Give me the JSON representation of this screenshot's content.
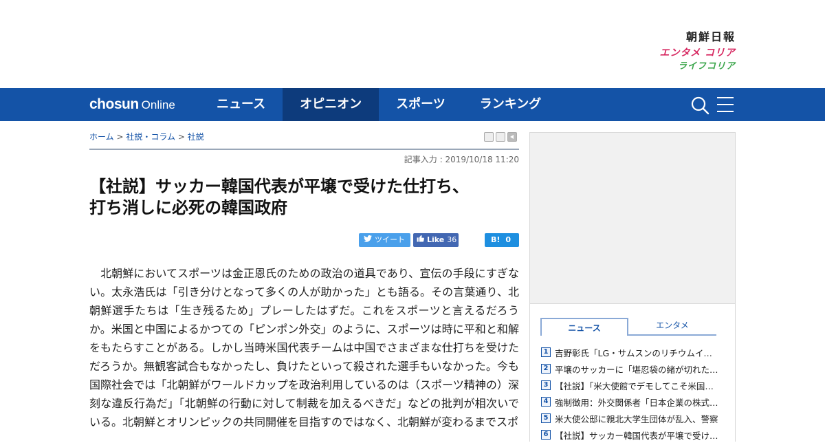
{
  "brands": {
    "chosun_ilbo": "朝鮮日報",
    "entame_korea": "エンタメ コリア",
    "life_korea": "ライフコリア"
  },
  "nav": {
    "logo_bold": "chosun",
    "logo_light": "Online",
    "items": [
      {
        "label": "ニュース",
        "active": false
      },
      {
        "label": "オピニオン",
        "active": true
      },
      {
        "label": "スポーツ",
        "active": false
      },
      {
        "label": "ランキング",
        "active": false
      }
    ],
    "icons": [
      "search-icon",
      "hamburger-menu-icon"
    ],
    "bar_color": "#1453a7",
    "active_color": "#0d3b7c"
  },
  "breadcrumb": {
    "home": "ホーム",
    "section": "社説・コラム",
    "current": "社説",
    "separator": ">"
  },
  "article": {
    "date": "記事入力 : 2019/10/18 11:20",
    "headline_line1": "【社説】サッカー韓国代表が平壌で受けた仕打ち、",
    "headline_line2": "打ち消しに必死の韓国政府",
    "body": "北朝鮮においてスポーツは金正恩氏のための政治の道具であり、宣伝の手段にすぎない。太永浩氏は「引き分けとなって多くの人が助かった」とも語る。その言葉通り、北朝鮮選手たちは「生き残るため」プレーしたはずだ。これをスポーツと言えるだろうか。米国と中国によるかつての「ピンポン外交」のように、スポーツは時に平和と和解をもたらすことがある。しかし当時米国代表チームは中国でさまざまな仕打ちを受けただろうか。無観客試合もなかったし、負けたといって殺された選手もいなかった。今も国際社会では「北朝鮮がワールドカップを政治利用しているのは（スポーツ精神の）深刻な違反行為だ」「北朝鮮の行動に対して制裁を加えるべきだ」などの批判が相次いでいる。北朝鮮とオリンピックの共同開催を目指すのではなく、北朝鮮が変わるまでスポ"
  },
  "share": {
    "tweet": "ツイート",
    "like": "Like",
    "like_count": "36",
    "hatena": "B!",
    "hatena_count": "0"
  },
  "sidebar": {
    "tabs": [
      {
        "label": "ニュース",
        "active": true
      },
      {
        "label": "エンタメ",
        "active": false
      }
    ],
    "ranking": [
      {
        "num": "1",
        "title": "吉野彰氏「LG・サムスンのリチウムイオン電池"
      },
      {
        "num": "2",
        "title": "平壌のサッカーに「堪忍袋の緒が切れた」韓国"
      },
      {
        "num": "3",
        "title": "【社説】「米大使館でデモしてこそ米国に伝わる"
      },
      {
        "num": "4",
        "title": "強制徴用：外交関係者「日本企業の株式売却"
      },
      {
        "num": "5",
        "title": "米大使公邸に親北大学生団体が乱入、警察"
      },
      {
        "num": "6",
        "title": "【社説】サッカー韓国代表が平壌で受けた仕打ち"
      }
    ]
  }
}
